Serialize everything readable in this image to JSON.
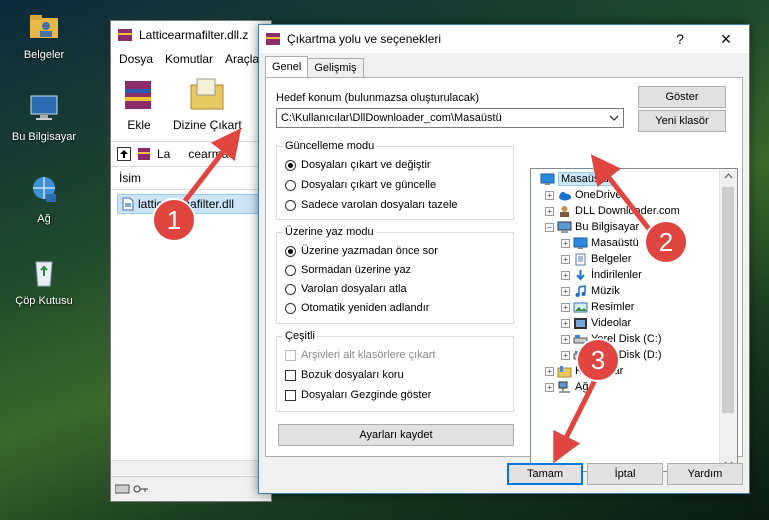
{
  "desktop": {
    "icons": [
      {
        "label": "Belgeler",
        "icon": "folder-user-icon"
      },
      {
        "label": "Bu Bilgisayar",
        "icon": "computer-icon"
      },
      {
        "label": "Ağ",
        "icon": "network-icon"
      },
      {
        "label": "Çöp Kutusu",
        "icon": "recycle-bin-icon"
      }
    ]
  },
  "bg_window": {
    "title": "Latticearmafilter.dll.z",
    "menu": [
      "Dosya",
      "Komutlar",
      "Araçla"
    ],
    "tools": [
      {
        "label": "Ekle"
      },
      {
        "label": "Dizine Çıkart"
      }
    ],
    "address": "La",
    "address_tail": "cearma",
    "column_header": "İsim",
    "file": "latticearmafilter.dll"
  },
  "dialog": {
    "title": "Çıkartma yolu ve seçenekleri",
    "help": "?",
    "close": "✕",
    "tabs": [
      "Genel",
      "Gelişmiş"
    ],
    "dest_label": "Hedef konum (bulunmazsa oluşturulacak)",
    "dest_value": "C:\\Kullanıcılar\\DllDownloader_com\\Masaüstü",
    "show_button": "Göster",
    "new_folder_button": "Yeni klasör",
    "update_mode": {
      "title": "Güncelleme modu",
      "options": [
        "Dosyaları çıkart ve değiştir",
        "Dosyaları çıkart ve güncelle",
        "Sadece varolan dosyaları tazele"
      ],
      "selected": 0
    },
    "overwrite_mode": {
      "title": "Üzerine yaz modu",
      "options": [
        "Üzerine yazmadan önce sor",
        "Sormadan üzerine yaz",
        "Varolan dosyaları atla",
        "Otomatik yeniden adlandır"
      ],
      "selected": 0
    },
    "misc": {
      "title": "Çeşitli",
      "options": [
        {
          "label": "Arşivleri alt klasörlere çıkart",
          "checked": false,
          "disabled": true
        },
        {
          "label": "Bozuk dosyaları koru",
          "checked": false,
          "disabled": false
        },
        {
          "label": "Dosyaları Gezginde göster",
          "checked": false,
          "disabled": false
        }
      ]
    },
    "save_settings": "Ayarları kaydet",
    "tree": [
      {
        "label": "Masaüstü",
        "level": 0,
        "expander": "",
        "icon": "desktop-icon",
        "selected": true
      },
      {
        "label": "OneDrive",
        "level": 1,
        "expander": "+",
        "icon": "onedrive-icon"
      },
      {
        "label": "DLL Downloader.com",
        "level": 1,
        "expander": "+",
        "icon": "user-folder-icon"
      },
      {
        "label": "Bu Bilgisayar",
        "level": 1,
        "expander": "−",
        "icon": "computer-icon"
      },
      {
        "label": "Masaüstü",
        "level": 2,
        "expander": "+",
        "icon": "desktop-icon"
      },
      {
        "label": "Belgeler",
        "level": 2,
        "expander": "+",
        "icon": "documents-icon"
      },
      {
        "label": "İndirilenler",
        "level": 2,
        "expander": "+",
        "icon": "downloads-icon"
      },
      {
        "label": "Müzik",
        "level": 2,
        "expander": "+",
        "icon": "music-icon"
      },
      {
        "label": "Resimler",
        "level": 2,
        "expander": "+",
        "icon": "pictures-icon"
      },
      {
        "label": "Videolar",
        "level": 2,
        "expander": "+",
        "icon": "videos-icon"
      },
      {
        "label": "Yerel Disk (C:)",
        "level": 2,
        "expander": "+",
        "icon": "drive-icon"
      },
      {
        "label": "Yerel Disk (D:)",
        "level": 2,
        "expander": "+",
        "icon": "drive-icon"
      },
      {
        "label": "Kitaplıklar",
        "level": 1,
        "expander": "+",
        "icon": "library-icon"
      },
      {
        "label": "Ağ",
        "level": 1,
        "expander": "+",
        "icon": "network-icon"
      }
    ],
    "ok": "Tamam",
    "cancel": "İptal",
    "help_button": "Yardım"
  },
  "annotations": [
    "1",
    "2",
    "3"
  ],
  "colors": {
    "accent": "#0078d7",
    "annotation": "#e0463f",
    "selection": "#cce8ff"
  }
}
